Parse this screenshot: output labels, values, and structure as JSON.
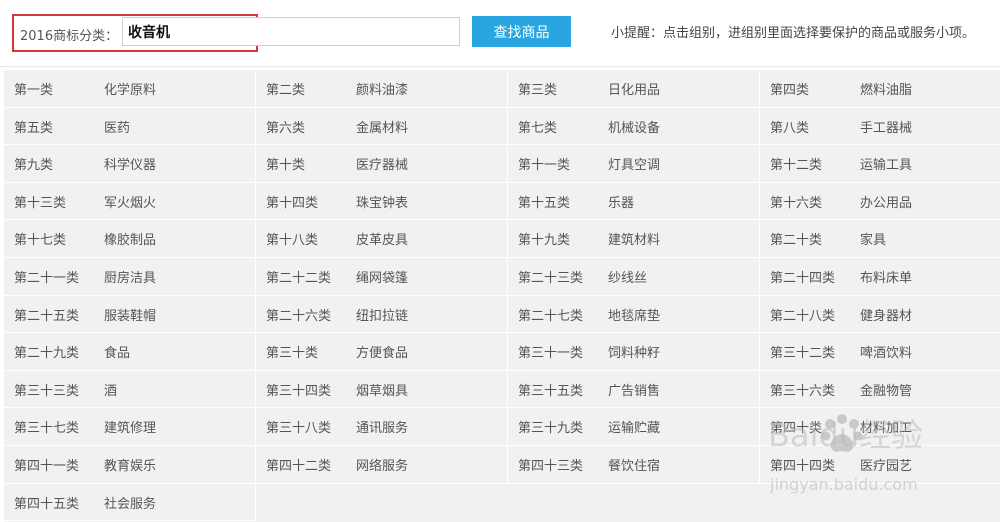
{
  "search": {
    "label": "2016商标分类：",
    "value": "收音机",
    "button_label": "查找商品",
    "tip": "小提醒：点击组别，进组别里面选择要保护的商品或服务小项。"
  },
  "classes": [
    {
      "number": "第一类",
      "name": "化学原料"
    },
    {
      "number": "第二类",
      "name": "颜料油漆"
    },
    {
      "number": "第三类",
      "name": "日化用品"
    },
    {
      "number": "第四类",
      "name": "燃料油脂"
    },
    {
      "number": "第五类",
      "name": "医药"
    },
    {
      "number": "第六类",
      "name": "金属材料"
    },
    {
      "number": "第七类",
      "name": "机械设备"
    },
    {
      "number": "第八类",
      "name": "手工器械"
    },
    {
      "number": "第九类",
      "name": "科学仪器"
    },
    {
      "number": "第十类",
      "name": "医疗器械"
    },
    {
      "number": "第十一类",
      "name": "灯具空调"
    },
    {
      "number": "第十二类",
      "name": "运输工具"
    },
    {
      "number": "第十三类",
      "name": "军火烟火"
    },
    {
      "number": "第十四类",
      "name": "珠宝钟表"
    },
    {
      "number": "第十五类",
      "name": "乐器"
    },
    {
      "number": "第十六类",
      "name": "办公用品"
    },
    {
      "number": "第十七类",
      "name": "橡胶制品"
    },
    {
      "number": "第十八类",
      "name": "皮革皮具"
    },
    {
      "number": "第十九类",
      "name": "建筑材料"
    },
    {
      "number": "第二十类",
      "name": "家具"
    },
    {
      "number": "第二十一类",
      "name": "厨房洁具"
    },
    {
      "number": "第二十二类",
      "name": "绳网袋篷"
    },
    {
      "number": "第二十三类",
      "name": "纱线丝"
    },
    {
      "number": "第二十四类",
      "name": "布料床单"
    },
    {
      "number": "第二十五类",
      "name": "服装鞋帽"
    },
    {
      "number": "第二十六类",
      "name": "纽扣拉链"
    },
    {
      "number": "第二十七类",
      "name": "地毯席垫"
    },
    {
      "number": "第二十八类",
      "name": "健身器材"
    },
    {
      "number": "第二十九类",
      "name": "食品"
    },
    {
      "number": "第三十类",
      "name": "方便食品"
    },
    {
      "number": "第三十一类",
      "name": "饲料种籽"
    },
    {
      "number": "第三十二类",
      "name": "啤酒饮料"
    },
    {
      "number": "第三十三类",
      "name": "酒"
    },
    {
      "number": "第三十四类",
      "name": "烟草烟具"
    },
    {
      "number": "第三十五类",
      "name": "广告销售"
    },
    {
      "number": "第三十六类",
      "name": "金融物管"
    },
    {
      "number": "第三十七类",
      "name": "建筑修理"
    },
    {
      "number": "第三十八类",
      "name": "通讯服务"
    },
    {
      "number": "第三十九类",
      "name": "运输贮藏"
    },
    {
      "number": "第四十类",
      "name": "材料加工"
    },
    {
      "number": "第四十一类",
      "name": "教育娱乐"
    },
    {
      "number": "第四十二类",
      "name": "网络服务"
    },
    {
      "number": "第四十三类",
      "name": "餐饮住宿"
    },
    {
      "number": "第四十四类",
      "name": "医疗园艺"
    },
    {
      "number": "第四十五类",
      "name": "社会服务"
    }
  ],
  "watermark": {
    "brand": "Baidu经验",
    "url": "jingyan.baidu.com"
  }
}
